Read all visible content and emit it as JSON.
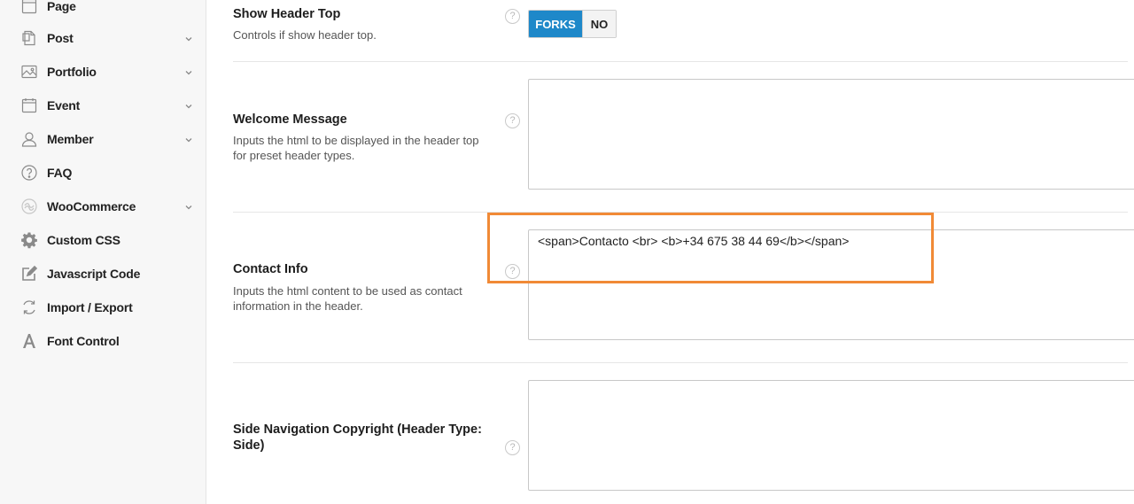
{
  "sidebar": {
    "items": [
      {
        "label": "Page",
        "icon": "page-icon",
        "has_chevron": false
      },
      {
        "label": "Post",
        "icon": "post-icon",
        "has_chevron": true
      },
      {
        "label": "Portfolio",
        "icon": "image-icon",
        "has_chevron": true
      },
      {
        "label": "Event",
        "icon": "calendar-icon",
        "has_chevron": true
      },
      {
        "label": "Member",
        "icon": "user-icon",
        "has_chevron": true
      },
      {
        "label": "FAQ",
        "icon": "question-icon",
        "has_chevron": false
      },
      {
        "label": "WooCommerce",
        "icon": "woocommerce-icon",
        "has_chevron": true
      },
      {
        "label": "Custom CSS",
        "icon": "gear-icon",
        "has_chevron": false
      },
      {
        "label": "Javascript Code",
        "icon": "edit-icon",
        "has_chevron": false
      },
      {
        "label": "Import / Export",
        "icon": "refresh-icon",
        "has_chevron": false
      },
      {
        "label": "Font Control",
        "icon": "font-icon",
        "has_chevron": false
      }
    ]
  },
  "settings": {
    "show_header_top": {
      "title": "Show Header Top",
      "description": "Controls if show header top.",
      "help": "?",
      "options": {
        "on": "FORKS",
        "off": "NO"
      },
      "selected": "on"
    },
    "welcome_message": {
      "title": "Welcome Message",
      "description": "Inputs the html to be displayed in the header top for preset header types.",
      "help": "?",
      "value": ""
    },
    "contact_info": {
      "title": "Contact Info",
      "description": "Inputs the html content to be used as contact information in the header.",
      "help": "?",
      "value": "<span>Contacto <br> <b>+34 675 38 44 69</b></span>"
    },
    "side_nav_copyright": {
      "title": "Side Navigation Copyright (Header Type: Side)",
      "help": "?",
      "value": ""
    }
  },
  "colors": {
    "accent": "#1e88c9",
    "highlight": "#f18a36"
  }
}
